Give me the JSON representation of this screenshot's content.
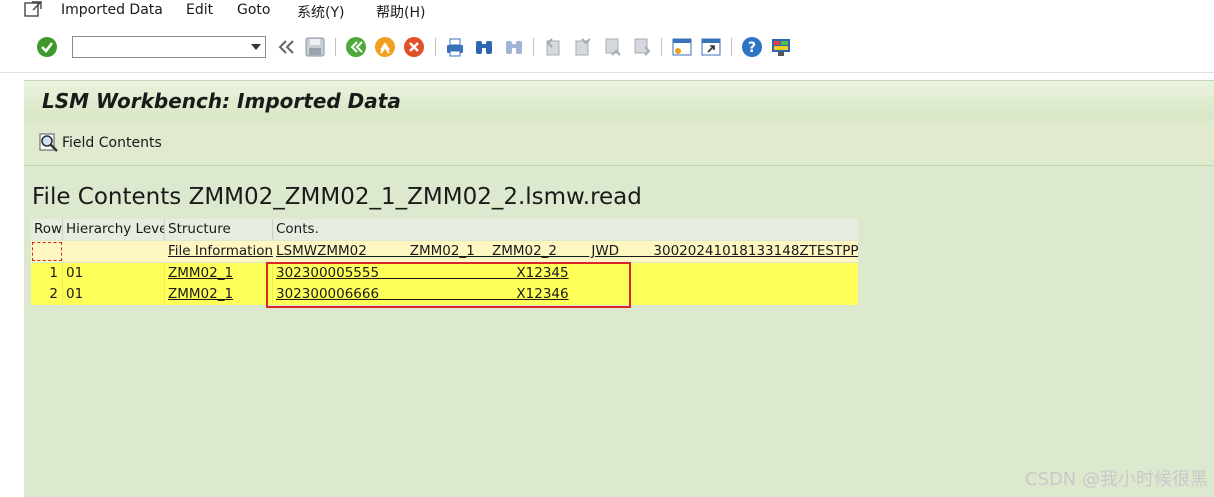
{
  "menu": {
    "items": [
      "Imported Data",
      "Edit",
      "Goto",
      "系统(Y)",
      "帮助(H)"
    ]
  },
  "toolbar": {
    "command_field_value": "",
    "icons": [
      "enter-check",
      "command-dropdown",
      "back-double-chevron",
      "save",
      "back",
      "exit",
      "cancel",
      "print",
      "find",
      "find-next",
      "first-page",
      "previous-page",
      "next-page",
      "last-page",
      "new-session",
      "create-shortcut",
      "help",
      "customize-layout"
    ]
  },
  "screen": {
    "title": "LSM Workbench: Imported Data",
    "field_contents_button": "Field Contents",
    "heading": "File Contents ZMM02_ZMM02_1_ZMM02_2.lsmw.read"
  },
  "table": {
    "headers": [
      "Row",
      "Hierarchy Level",
      "Structure",
      "Conts."
    ],
    "info_row": {
      "row": "",
      "level": "",
      "structure": "File Information",
      "conts": "LSMWZMM02          ZMM02_1    ZMM02_2        JWD        30020241018133148ZTESTPP"
    },
    "rows": [
      {
        "row": "1",
        "level": "01",
        "structure": "ZMM02_1",
        "conts": "302300005555                                X12345"
      },
      {
        "row": "2",
        "level": "01",
        "structure": "ZMM02_1",
        "conts": "302300006666                                X12346"
      }
    ]
  },
  "colors": {
    "main_bg": "#dde9cf",
    "highlight_row": "#ffff5a",
    "annotation_red": "#d8262b"
  },
  "watermark": "CSDN @我小时候很黑"
}
